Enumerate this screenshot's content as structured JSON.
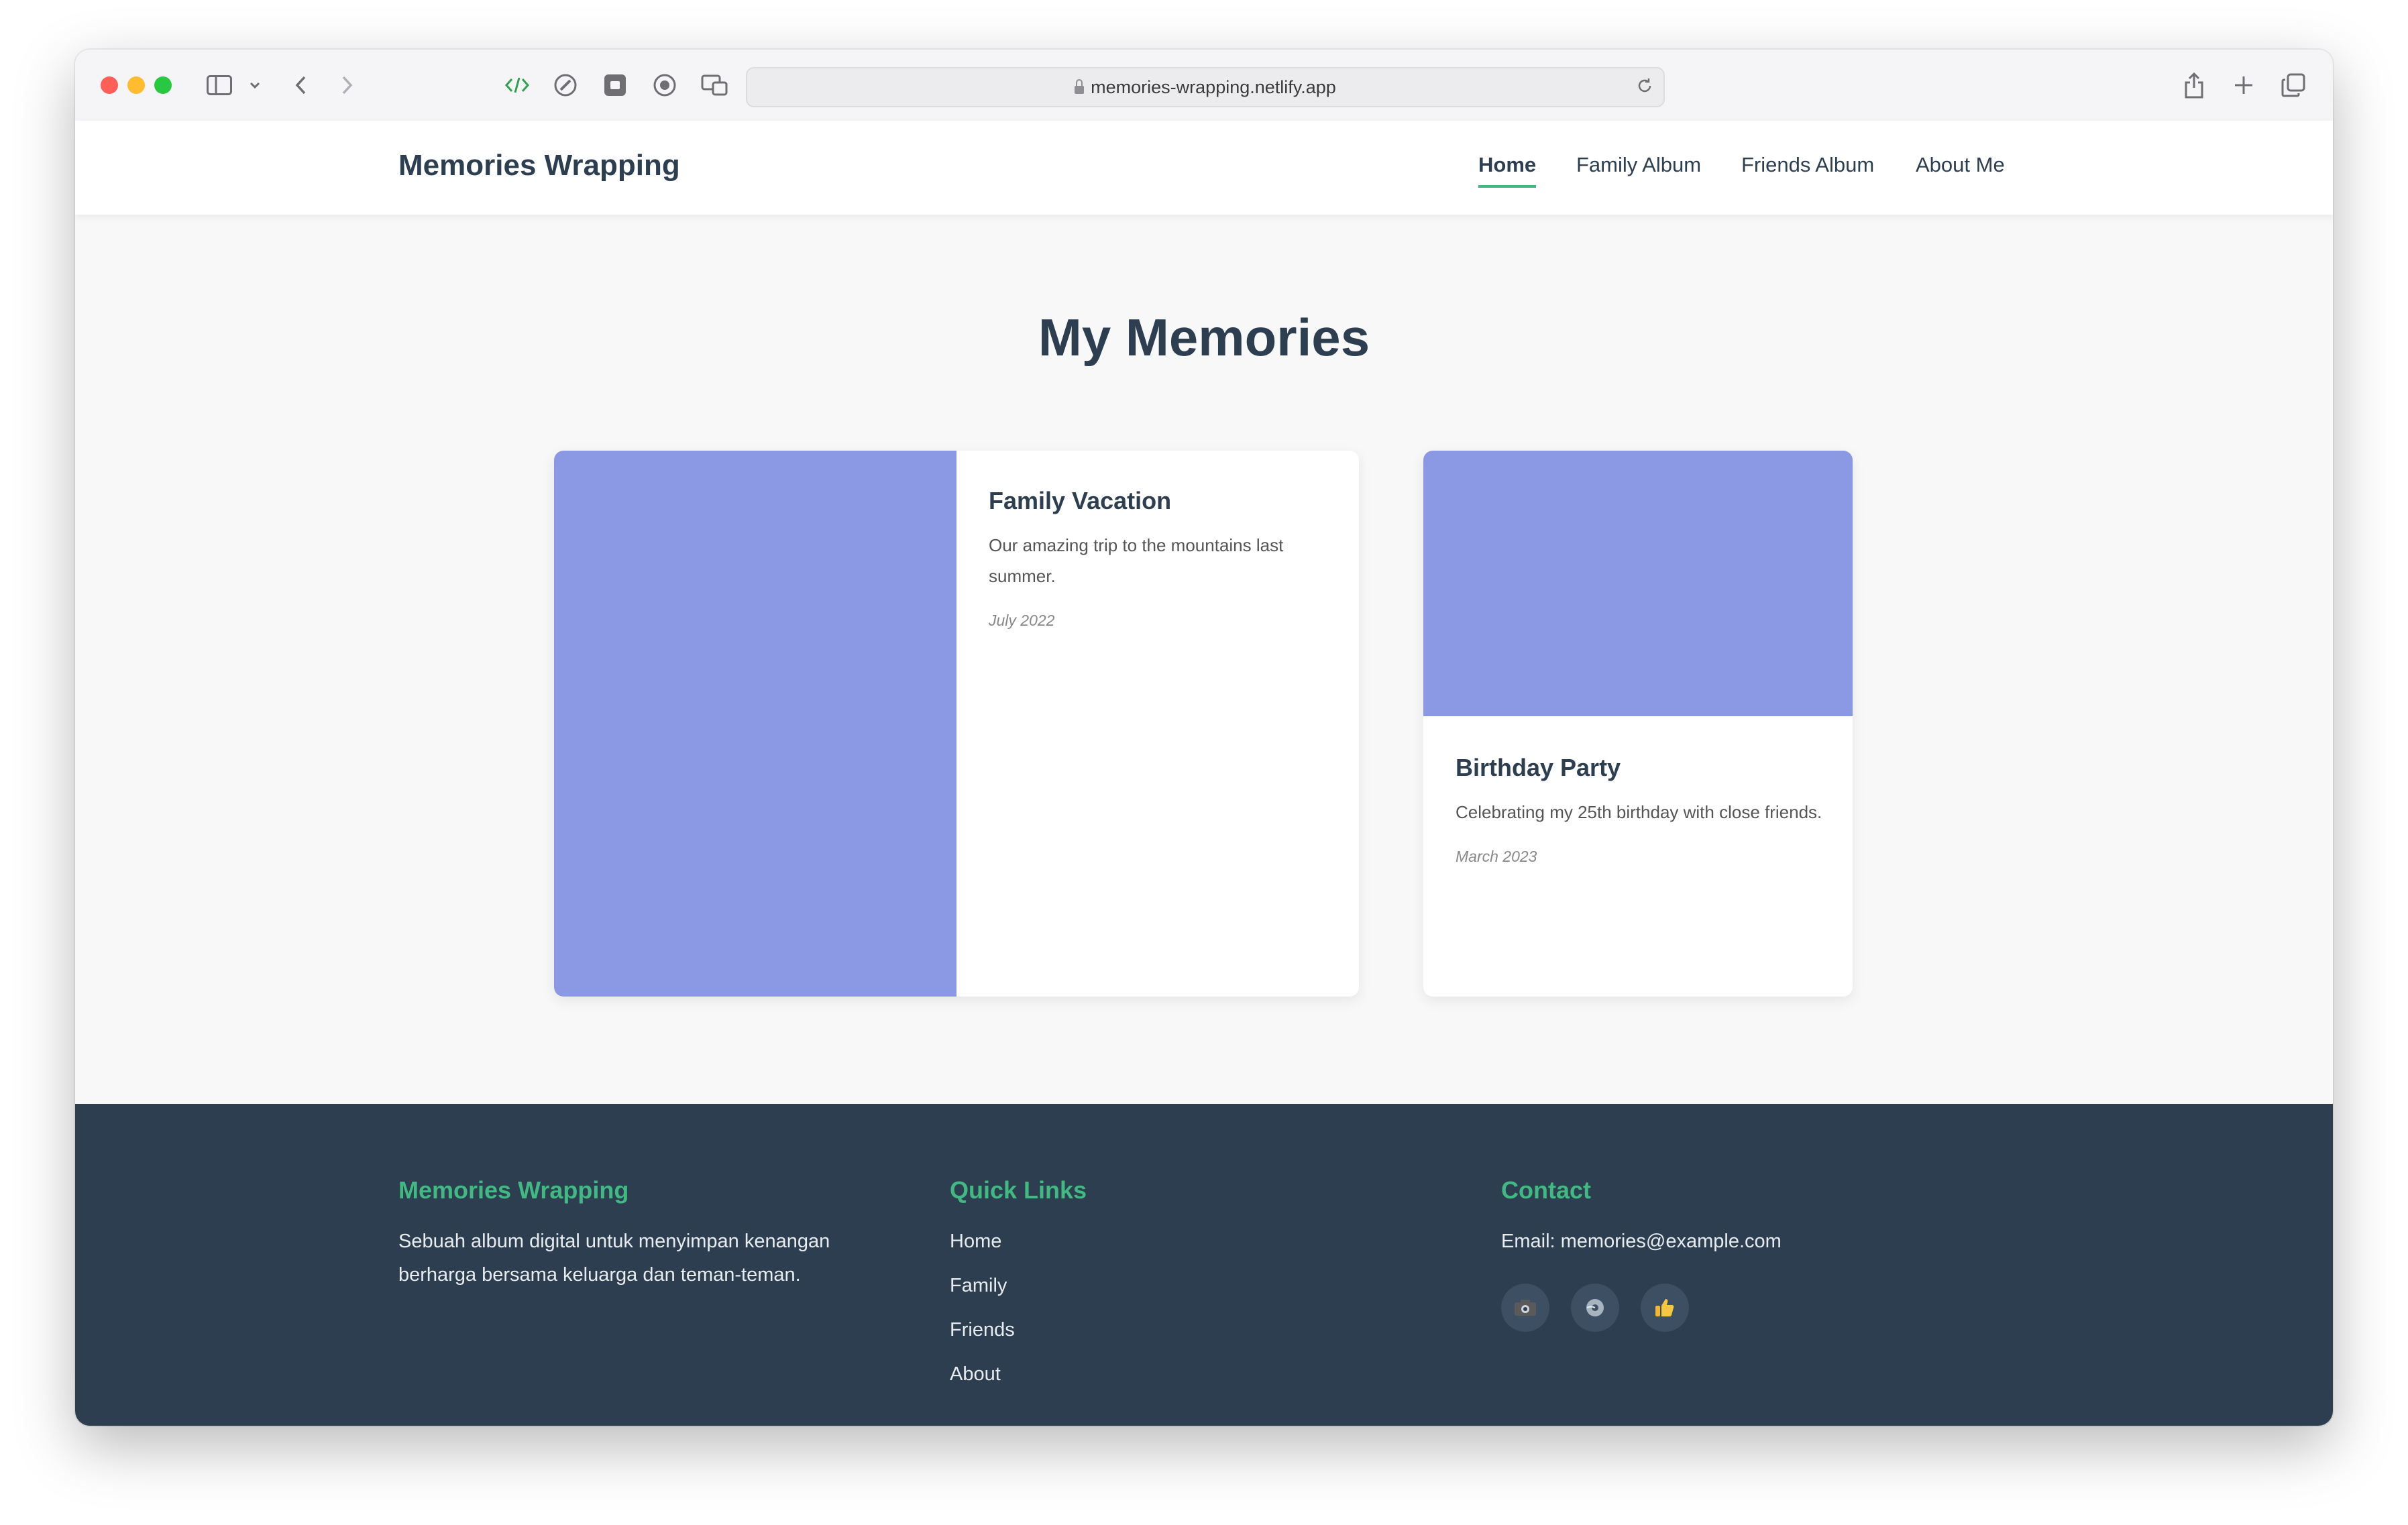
{
  "browser": {
    "url": "memories-wrapping.netlify.app"
  },
  "header": {
    "logo": "Memories Wrapping",
    "nav": [
      {
        "label": "Home",
        "active": true
      },
      {
        "label": "Family Album",
        "active": false
      },
      {
        "label": "Friends Album",
        "active": false
      },
      {
        "label": "About Me",
        "active": false
      }
    ]
  },
  "main": {
    "title": "My Memories",
    "cards": [
      {
        "title": "Family Vacation",
        "description": "Our amazing trip to the mountains last summer.",
        "date": "July 2022"
      },
      {
        "title": "Birthday Party",
        "description": "Celebrating my 25th birthday with close friends.",
        "date": "March 2023"
      }
    ]
  },
  "footer": {
    "about": {
      "heading": "Memories Wrapping",
      "text": "Sebuah album digital untuk menyimpan kenangan berharga bersama keluarga dan teman-teman."
    },
    "quick_links": {
      "heading": "Quick Links",
      "links": [
        "Home",
        "Family",
        "Friends",
        "About"
      ]
    },
    "contact": {
      "heading": "Contact",
      "email": "Email: memories@example.com",
      "socials": [
        "camera-icon",
        "globe-icon",
        "thumbs-up-icon"
      ]
    }
  },
  "colors": {
    "accent": "#42b983",
    "dark": "#2c3e50",
    "card_image": "#8b98e3"
  }
}
